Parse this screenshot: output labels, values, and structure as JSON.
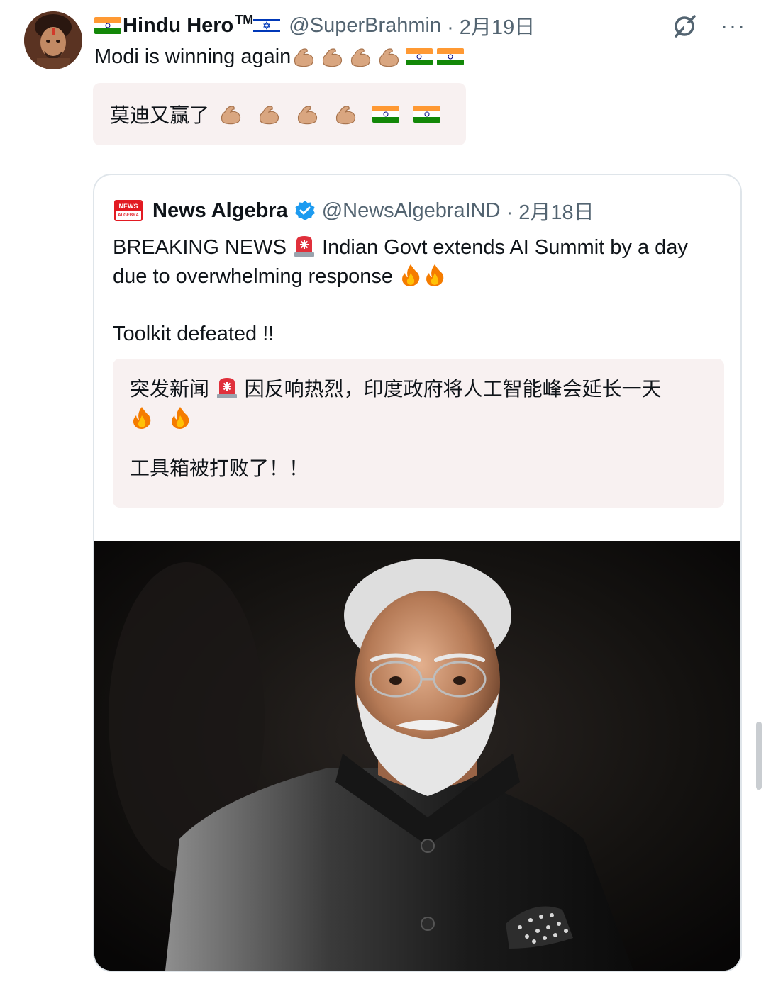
{
  "tweet": {
    "display_name": "Hindu Hero",
    "trademark": "TM",
    "handle": "@SuperBrahmin",
    "date": "· 2月19日",
    "text": "Modi is winning again",
    "translation": "莫迪又赢了",
    "emoji": [
      "flexed-biceps",
      "flexed-biceps",
      "flexed-biceps",
      "flexed-biceps",
      "india-flag",
      "india-flag"
    ]
  },
  "actions": {
    "grok_icon": "grok-icon",
    "more_label": "···"
  },
  "quote": {
    "logo_top": "NEWS",
    "logo_bottom": "ALGEBRA",
    "display_name": "News Algebra",
    "handle": "@NewsAlgebraIND",
    "date": "· 2月18日",
    "line1_a": "BREAKING NEWS",
    "line1_b": "Indian Govt extends AI Summit by a day",
    "line2": "due to overwhelming response",
    "line3": "Toolkit defeated !!",
    "translation_line1_a": "突发新闻",
    "translation_line1_b": "因反响热烈，印度政府将人工智能峰会延长一天",
    "translation_line3": "工具箱被打败了！！",
    "image_subject": "portrait-photo"
  },
  "colors": {
    "text": "#0f1419",
    "muted": "#536471",
    "translation_bg": "#f8f1f1",
    "border": "#dfe5ea",
    "verified": "#1d9bf0"
  }
}
